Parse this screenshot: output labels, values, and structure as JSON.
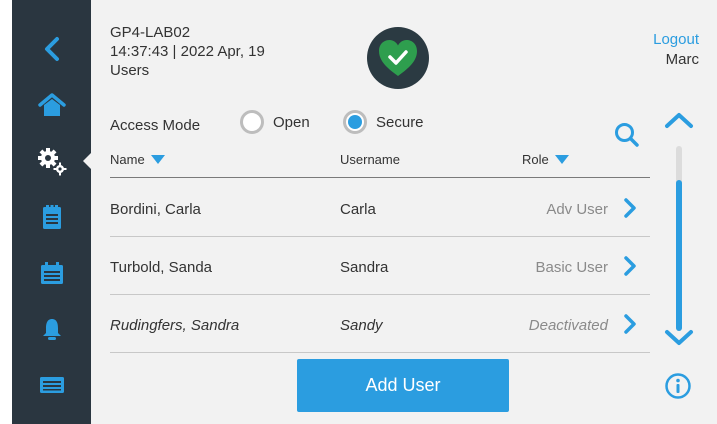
{
  "header": {
    "device_name": "GP4-LAB02",
    "datetime": "14:37:43 | 2022 Apr, 19",
    "page_title": "Users",
    "status_icon": "heart-check-icon"
  },
  "account": {
    "logout_label": "Logout",
    "user": "Marc"
  },
  "sidebar": {
    "items": [
      {
        "icon": "back-chevron-icon"
      },
      {
        "icon": "home-icon"
      },
      {
        "icon": "settings-gears-icon",
        "active": true
      },
      {
        "icon": "clipboard-icon"
      },
      {
        "icon": "calendar-icon"
      },
      {
        "icon": "bell-icon"
      },
      {
        "icon": "terminal-screen-icon"
      }
    ]
  },
  "access_mode": {
    "label": "Access Mode",
    "options": [
      "Open",
      "Secure"
    ],
    "selected": "Secure"
  },
  "table": {
    "columns": [
      "Name",
      "Username",
      "Role"
    ],
    "rows": [
      {
        "name": "Bordini, Carla",
        "username": "Carla",
        "role": "Adv User",
        "deactivated": false
      },
      {
        "name": "Turbold, Sanda",
        "username": "Sandra",
        "role": "Basic User",
        "deactivated": false
      },
      {
        "name": "Rudingfers, Sandra",
        "username": "Sandy",
        "role": "Deactivated",
        "deactivated": true
      }
    ]
  },
  "actions": {
    "add_user_label": "Add User"
  },
  "colors": {
    "accent": "#2b9de0",
    "sidebar": "#2a3640",
    "status_ok": "#2e9e4e"
  }
}
